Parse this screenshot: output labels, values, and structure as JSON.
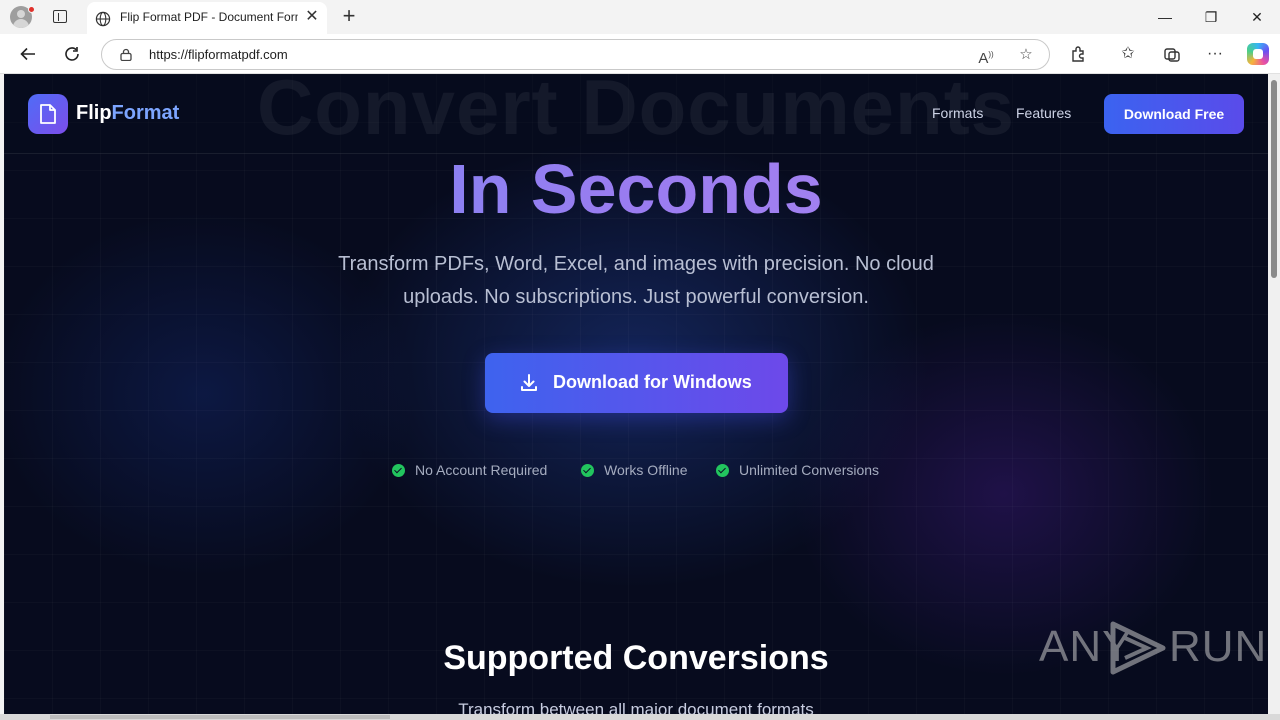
{
  "browser": {
    "tab_title": "Flip Format PDF - Document Form",
    "tab_close": "✕",
    "new_tab": "+",
    "url": "https://flipformatpdf.com",
    "window_controls": {
      "minimize": "—",
      "maximize": "❐",
      "close": "✕"
    }
  },
  "site": {
    "logo": {
      "part1": "Flip",
      "part2": "Format"
    },
    "ghost_heading": "Convert Documents",
    "nav": {
      "formats": "Formats",
      "features": "Features",
      "cta": "Download Free"
    },
    "hero": {
      "title": "In Seconds",
      "subtitle_line1": "Transform PDFs, Word, Excel, and images with precision. No cloud",
      "subtitle_line2": "uploads. No subscriptions. Just powerful conversion.",
      "cta": "Download for Windows",
      "features": [
        "No Account Required",
        "Works Offline",
        "Unlimited Conversions"
      ]
    },
    "section": {
      "title": "Supported Conversions",
      "subtitle": "Transform between all major document formats"
    },
    "watermark": {
      "left": "ANY",
      "right": "RUN"
    }
  },
  "colors": {
    "page_bg": "#070b1e",
    "accent_blue": "#3e63ee",
    "accent_purple": "#6d49ea",
    "check_green": "#22c55e"
  }
}
